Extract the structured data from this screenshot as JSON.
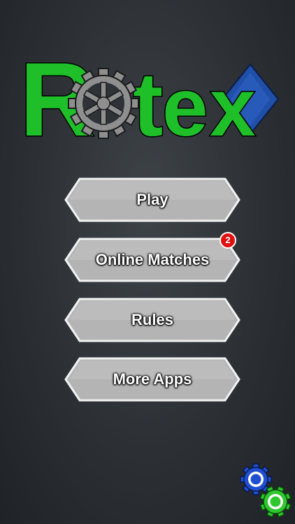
{
  "logo": {
    "letters": [
      "R",
      "t",
      "e",
      "x"
    ],
    "wordmark": "Rotex"
  },
  "menu": {
    "buttons": [
      {
        "id": "play",
        "label": "Play",
        "badge": ""
      },
      {
        "id": "online-matches",
        "label": "Online Matches",
        "badge": "2"
      },
      {
        "id": "rules",
        "label": "Rules",
        "badge": ""
      },
      {
        "id": "more-apps",
        "label": "More Apps",
        "badge": ""
      }
    ]
  },
  "icons": {
    "logo_gear": "gear-icon",
    "logo_diamond": "blue-diamond-icon",
    "settings": "settings-gears-icon"
  },
  "colors": {
    "logo_green": "#1fbf2a",
    "logo_outline": "#0a0a0a",
    "gear_gray": "#8f8f8f",
    "diamond_blue": "#1f4fa8",
    "button_fill": "#b4b4b4",
    "button_border": "#f2f2f2",
    "badge_red": "#e01010",
    "gear_small_blue": "#1f4fd0",
    "gear_small_green": "#2ec72e"
  }
}
